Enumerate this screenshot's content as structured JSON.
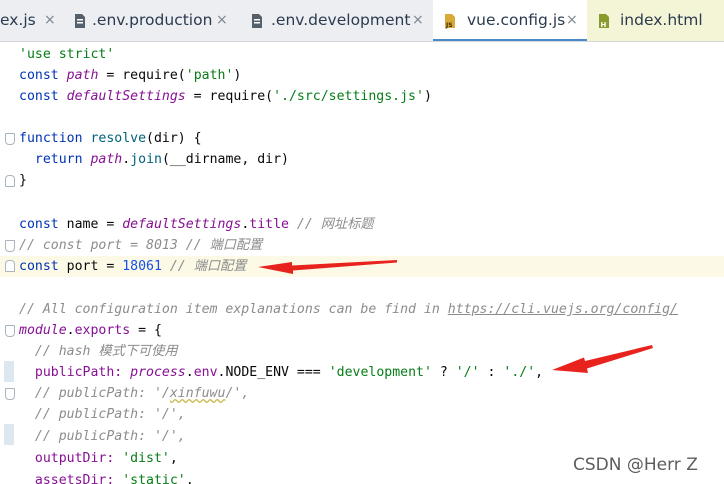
{
  "tabs": [
    {
      "label": "ex.js",
      "active": false
    },
    {
      "label": ".env.production",
      "active": false
    },
    {
      "label": ".env.development",
      "active": false
    },
    {
      "label": "vue.config.js",
      "active": true
    },
    {
      "label": "index.html",
      "active": false
    }
  ],
  "close_glyph": "×",
  "code": {
    "l1": {
      "s1": "'use strict'"
    },
    "l2": {
      "k": "const ",
      "v": "path",
      "p": " = require(",
      "s": "'path'",
      "e": ")"
    },
    "l3": {
      "k": "const ",
      "v": "defaultSettings",
      "p": " = require(",
      "s": "'./src/settings.js'",
      "e": ")"
    },
    "l5": {
      "k": "function ",
      "f": "resolve",
      "p": "(dir) {"
    },
    "l6": {
      "ind": "  ",
      "k": "return ",
      "v": "path",
      "d": ".",
      "f": "join",
      "p": "(__dirname, dir)"
    },
    "l7": {
      "p": "}"
    },
    "l9": {
      "k": "const ",
      "p": "name = ",
      "v": "defaultSettings",
      "d": ".",
      "pr": "title",
      "c": " // 网址标题"
    },
    "l10": {
      "c": "// const port = 8013 // 端口配置"
    },
    "l11": {
      "k": "const ",
      "p": "port = ",
      "n": "18061",
      "c": " // 端口配置"
    },
    "l13": {
      "c": "// All configuration item explanations can be find in ",
      "u": "https://cli.vuejs.org/config/"
    },
    "l14": {
      "v": "module",
      "d": ".",
      "pr": "exports",
      "p": " = {"
    },
    "l15": {
      "c": "  // hash 模式下可使用"
    },
    "l16": {
      "ind": "  ",
      "p": "publicPath: ",
      "v": "process",
      "d": ".",
      "pr": "env",
      "d2": ".NODE_ENV === ",
      "s": "'development'",
      "q": " ? ",
      "s2": "'/'",
      "co": " : ",
      "s3": "'./'",
      "e": ","
    },
    "l17": {
      "c1": "  // publicPath: '/",
      "sq": "xinfuwu",
      "c2": "/',"
    },
    "l18": {
      "c": "  // publicPath: '/',"
    },
    "l19": {
      "c": "  // publicPath: '/',"
    },
    "l20": {
      "ind": "  ",
      "p": "outputDir: ",
      "s": "'dist'",
      "e": ","
    },
    "l21": {
      "ind": "  ",
      "p": "assetsDir: ",
      "s": "'static'",
      "e": ","
    }
  },
  "watermark": "CSDN @Herr  Z"
}
